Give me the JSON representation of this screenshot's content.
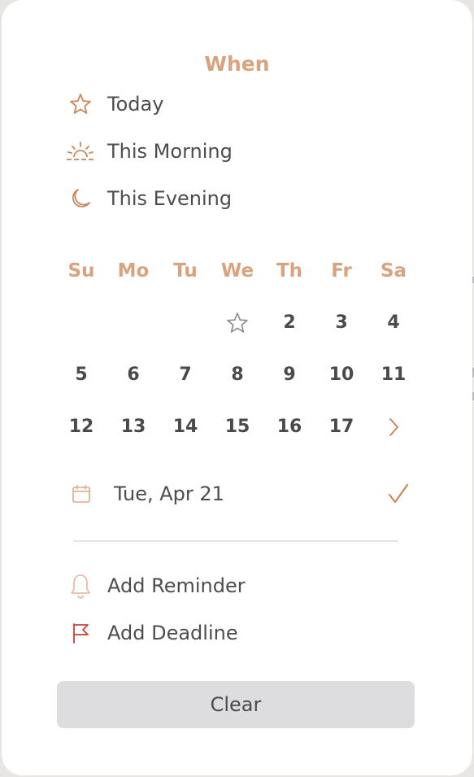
{
  "title": "When",
  "options": [
    {
      "label": "Today",
      "icon": "star-icon"
    },
    {
      "label": "This Morning",
      "icon": "sunrise-icon"
    },
    {
      "label": "This Evening",
      "icon": "moon-icon"
    }
  ],
  "calendar": {
    "weekdays": [
      "Su",
      "Mo",
      "Tu",
      "We",
      "Th",
      "Fr",
      "Sa"
    ],
    "week1": [
      "",
      "",
      "",
      "",
      "2",
      "3",
      "4"
    ],
    "week2": [
      "5",
      "6",
      "7",
      "8",
      "9",
      "10",
      "11"
    ],
    "week3": [
      "12",
      "13",
      "14",
      "15",
      "16",
      "17",
      ""
    ],
    "today_icon": "star-icon",
    "next_icon": "chevron-right-icon"
  },
  "selected_date": {
    "label": "Tue, Apr 21",
    "icon": "calendar-icon",
    "confirm_icon": "checkmark-icon"
  },
  "reminder": {
    "label": "Add Reminder",
    "icon": "bell-icon"
  },
  "deadline": {
    "label": "Add Deadline",
    "icon": "flag-icon"
  },
  "clear_label": "Clear",
  "colors": {
    "accent": "#d8a37e",
    "icon": "#c9875a",
    "text": "#4d4d4d",
    "flag": "#c9403a",
    "button_bg": "#dddddf"
  }
}
